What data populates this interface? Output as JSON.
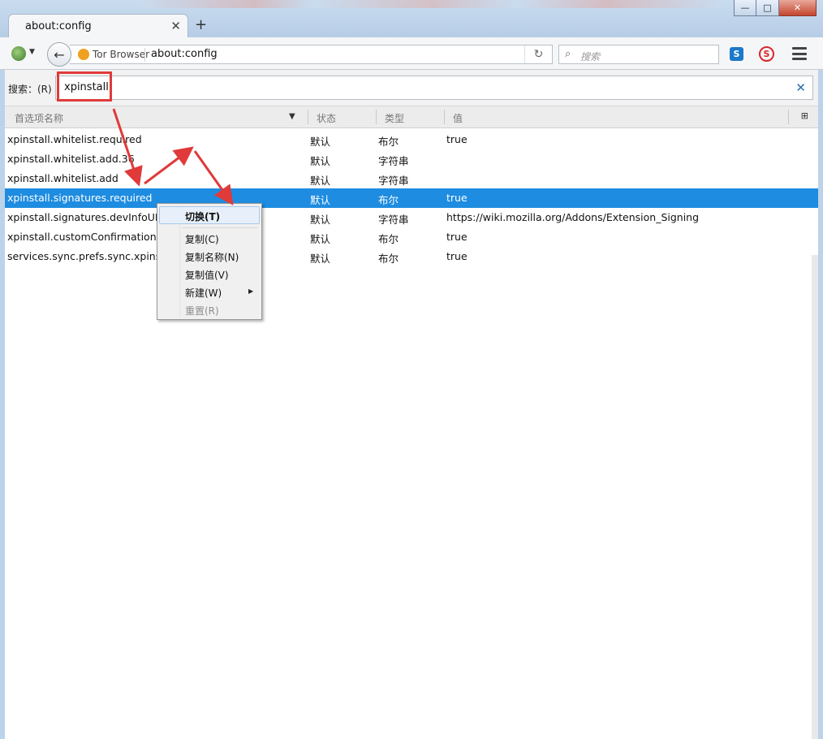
{
  "window": {
    "minimize": "—",
    "maximize": "□",
    "close": "✕"
  },
  "tab": {
    "title": "about:config",
    "close": "✕",
    "new_tab": "+"
  },
  "navbar": {
    "identity_name": "Tor Browser",
    "url": "about:config",
    "search_placeholder": "搜索",
    "reload_icon": "reload-icon"
  },
  "config": {
    "search_label": "搜索：(R)",
    "search_value": "xpinstall",
    "clear_icon": "✕",
    "columns": [
      "首选项名称",
      "状态",
      "类型",
      "值"
    ],
    "rows": [
      {
        "name": "xpinstall.whitelist.required",
        "status": "默认",
        "type": "布尔",
        "value": "true"
      },
      {
        "name": "xpinstall.whitelist.add.36",
        "status": "默认",
        "type": "字符串",
        "value": ""
      },
      {
        "name": "xpinstall.whitelist.add",
        "status": "默认",
        "type": "字符串",
        "value": ""
      },
      {
        "name": "xpinstall.signatures.required",
        "status": "默认",
        "type": "布尔",
        "value": "true",
        "selected": true
      },
      {
        "name": "xpinstall.signatures.devInfoURL",
        "status": "默认",
        "type": "字符串",
        "value": "https://wiki.mozilla.org/Addons/Extension_Signing"
      },
      {
        "name": "xpinstall.customConfirmationUI",
        "status": "默认",
        "type": "布尔",
        "value": "true"
      },
      {
        "name": "services.sync.prefs.sync.xpinstall",
        "status": "默认",
        "type": "布尔",
        "value": "true"
      }
    ]
  },
  "context_menu": {
    "items": [
      "切换(T)",
      "复制(C)",
      "复制名称(N)",
      "复制值(V)",
      "新建(W)",
      "重置(R)"
    ],
    "disabled": [
      "重置(R)"
    ]
  },
  "colors": {
    "selection": "#1e8ce0",
    "annotation": "#e03a3a"
  }
}
